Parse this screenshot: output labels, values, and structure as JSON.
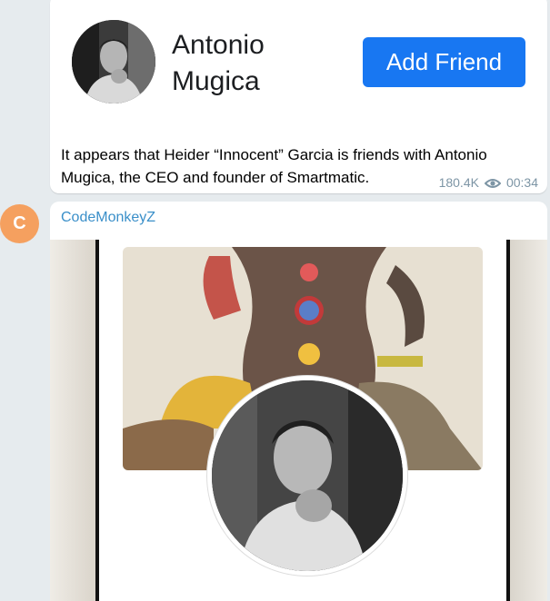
{
  "post1": {
    "profile_name": "Antonio Mugica",
    "add_friend_label": "Add Friend",
    "text": "It appears that Heider “Innocent” Garcia is friends with Antonio Mugica, the CEO and founder of Smartmatic.",
    "views": "180.4K",
    "time": "00:34",
    "view_icon": "eye-icon"
  },
  "post2": {
    "sender_initial": "C",
    "sender_name": "CodeMonkeyZ",
    "avatar_color": "#f5a05f"
  },
  "colors": {
    "accent": "#1877f2",
    "sender_name": "#3a8fc9",
    "meta": "#7d95a5"
  }
}
